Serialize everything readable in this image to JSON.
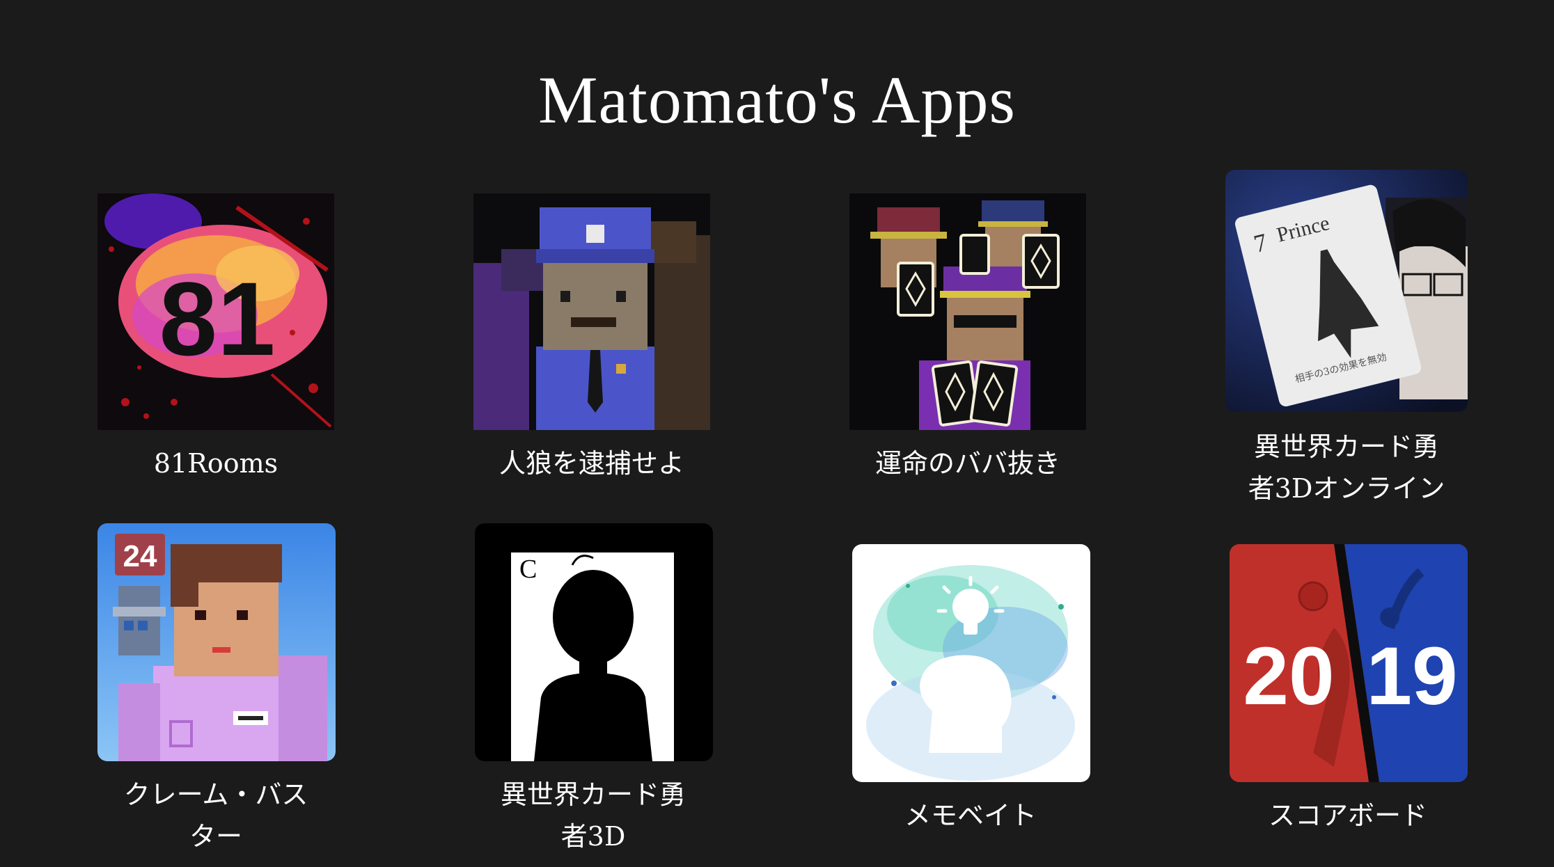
{
  "page": {
    "title": "Matomato's Apps"
  },
  "colors": {
    "background": "#1b1b1b",
    "text": "#ffffff"
  },
  "apps": [
    {
      "label": "81Rooms",
      "icon": "81rooms-app-icon",
      "icon_text": "81"
    },
    {
      "label": "人狼を逮捕せよ",
      "icon": "police-officer-app-icon"
    },
    {
      "label": "運命のババ抜き",
      "icon": "card-gangsters-app-icon"
    },
    {
      "label_line1": "異世界カード勇",
      "label_line2": "者3Dオンライン",
      "icon": "prince-card-app-icon",
      "card_number": "7",
      "card_name": "Prince",
      "card_text": "相手の3の効果を無効"
    },
    {
      "label_line1": "クレーム・バス",
      "label_line2": "ター",
      "icon": "claim-buster-app-icon",
      "badge": "24"
    },
    {
      "label_line1": "異世界カード勇",
      "label_line2": "者3D",
      "icon": "silhouette-card-app-icon",
      "card_letter": "C"
    },
    {
      "label": "メモベイト",
      "icon": "memo-bait-app-icon"
    },
    {
      "label": "スコアボード",
      "icon": "scoreboard-app-icon",
      "year_left": "20",
      "year_right": "19"
    }
  ]
}
